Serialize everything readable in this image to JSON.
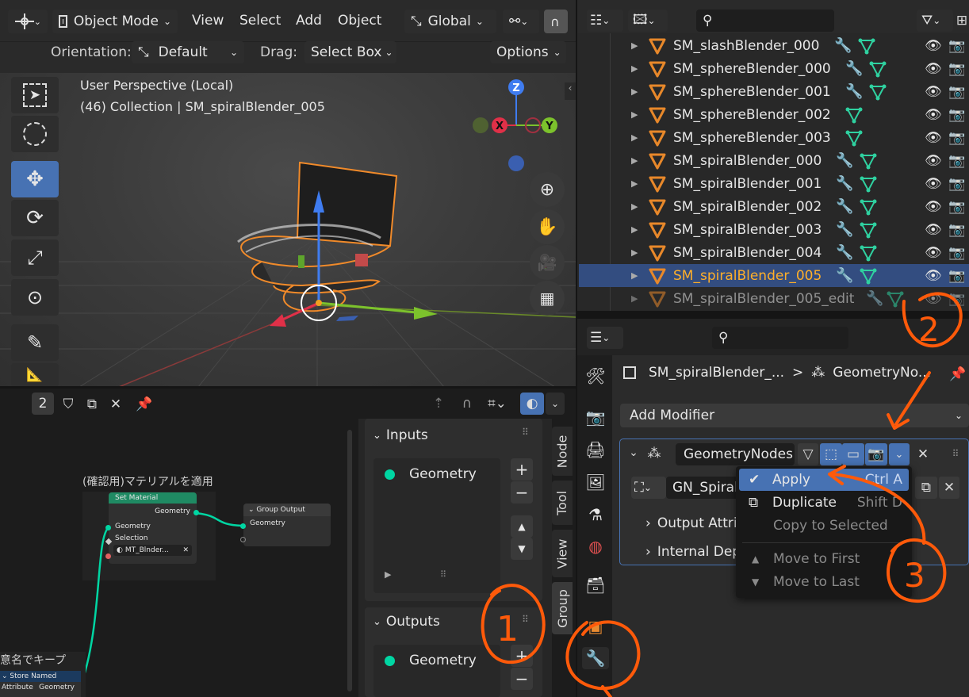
{
  "viewport_header": {
    "mode": "Object Mode",
    "menus": [
      "View",
      "Select",
      "Add",
      "Object"
    ],
    "transform_orientation": "Global"
  },
  "tool_settings": {
    "orientation_label": "Orientation:",
    "orientation_value": "Default",
    "drag_label": "Drag:",
    "drag_value": "Select Box",
    "options_label": "Options"
  },
  "viewport": {
    "perspective": "User Perspective (Local)",
    "collection_info": "(46) Collection | SM_spiralBlender_005",
    "gizmo": {
      "x": "X",
      "y": "Y",
      "z": "Z"
    }
  },
  "outliner": {
    "rows": [
      {
        "name": "SM_slashBlender_000",
        "modifier": true
      },
      {
        "name": "SM_sphereBlender_000",
        "modifier": true
      },
      {
        "name": "SM_sphereBlender_001",
        "modifier": true
      },
      {
        "name": "SM_sphereBlender_002",
        "modifier": false
      },
      {
        "name": "SM_sphereBlender_003",
        "modifier": false
      },
      {
        "name": "SM_spiralBlender_000",
        "modifier": true
      },
      {
        "name": "SM_spiralBlender_001",
        "modifier": true
      },
      {
        "name": "SM_spiralBlender_002",
        "modifier": true
      },
      {
        "name": "SM_spiralBlender_003",
        "modifier": true
      },
      {
        "name": "SM_spiralBlender_004",
        "modifier": true
      },
      {
        "name": "SM_spiralBlender_005",
        "modifier": true,
        "selected": true
      },
      {
        "name": "SM_spiralBlender_005_edit",
        "modifier": true,
        "dimmed": true
      }
    ]
  },
  "node_editor": {
    "user_count": "2",
    "frame_label": "(確認用)マテリアルを適用",
    "bottom_frame_label": "意名でキープ",
    "set_material": {
      "title": "Set Material",
      "out_geometry": "Geometry",
      "in_geometry": "Geometry",
      "selection": "Selection",
      "material": "MT_Blnder..."
    },
    "group_output": {
      "title": "Group Output",
      "geometry": "Geometry"
    },
    "store_named_attribute": {
      "title": "Store Named Attribute",
      "geometry": "Geometry"
    }
  },
  "node_sidebar": {
    "inputs_label": "Inputs",
    "inputs_item": "Geometry",
    "outputs_label": "Outputs",
    "outputs_item": "Geometry",
    "tabs": [
      "Node",
      "Tool",
      "View",
      "Group"
    ]
  },
  "properties": {
    "breadcrumb_object": "SM_spiralBlender_...",
    "breadcrumb_sep": ">",
    "breadcrumb_modifier": "GeometryNo...",
    "add_modifier": "Add Modifier",
    "modifier_name": "GeometryNodes",
    "node_group": "GN_Spiral",
    "output_attributes": "Output Attrib",
    "internal_dependencies": "Internal Dep"
  },
  "context_menu": {
    "items": [
      {
        "label": "Apply",
        "shortcut": "Ctrl A",
        "active": true
      },
      {
        "label": "Duplicate",
        "shortcut": "Shift D"
      },
      {
        "label": "Copy to Selected",
        "shortcut": ""
      },
      {
        "label": "Move to First",
        "shortcut": ""
      },
      {
        "label": "Move to Last",
        "shortcut": ""
      }
    ]
  },
  "annotations": {
    "step1": "1",
    "step2": "2",
    "step3": "3"
  },
  "colors": {
    "accent": "#4772b3",
    "selected_row": "#334d80",
    "annotation": "#ff5a0a",
    "selected_text": "#ffaf29",
    "node_header_green": "#1f8a63",
    "socket_green": "#00d6a3"
  }
}
